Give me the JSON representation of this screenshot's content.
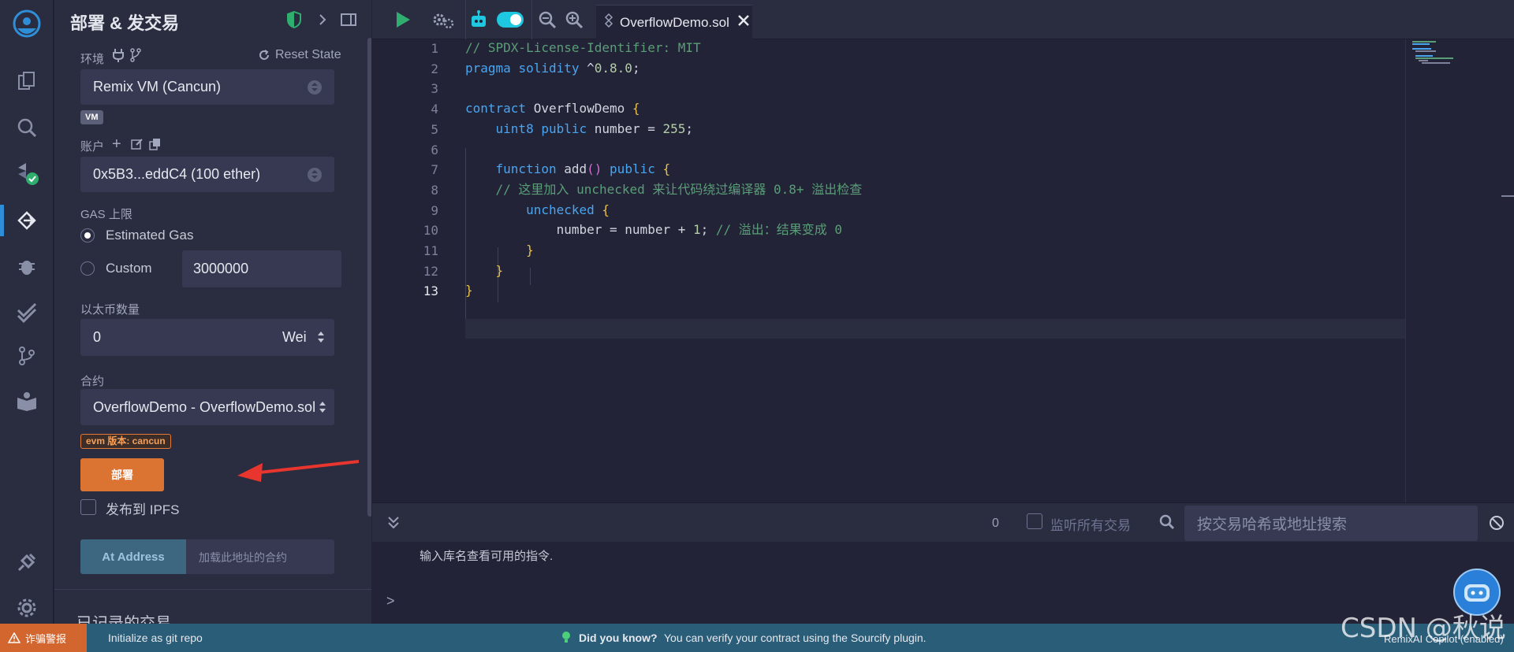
{
  "panel": {
    "title": "部署 & 发交易",
    "env_label": "环境",
    "reset_state": "Reset State",
    "env_value": "Remix VM (Cancun)",
    "vm_badge": "VM",
    "account_label": "账户",
    "account_value": "0x5B3...eddC4 (100 ether)",
    "gas_label": "GAS 上限",
    "gas_estimated": "Estimated Gas",
    "gas_custom": "Custom",
    "gas_custom_value": "3000000",
    "value_label": "以太币数量",
    "value_amount": "0",
    "value_unit": "Wei",
    "contract_label": "合约",
    "contract_value": "OverflowDemo - OverflowDemo.sol",
    "evm_badge": "evm 版本: cancun",
    "deploy_button": "部署",
    "publish_ipfs": "发布到 IPFS",
    "at_address_button": "At Address",
    "at_address_placeholder": "加载此地址的合约",
    "recorded_tx": "已记录的交易"
  },
  "editor": {
    "tab_name": "OverflowDemo.sol",
    "line_numbers": [
      "1",
      "2",
      "3",
      "4",
      "5",
      "6",
      "7",
      "8",
      "9",
      "10",
      "11",
      "12",
      "13"
    ],
    "lines": [
      "// SPDX-License-Identifier: MIT",
      "pragma solidity ^0.8.0;",
      "",
      "contract OverflowDemo {",
      "    uint8 public number = 255;",
      "",
      "    function add() public {",
      "    // 这里加入 unchecked 来让代码绕过编译器 0.8+ 溢出检查",
      "        unchecked {",
      "            number = number + 1; // 溢出：结果变成 0",
      "        }",
      "    }",
      "}"
    ]
  },
  "terminal": {
    "tx_count": "0",
    "listen_all": "监听所有交易",
    "search_placeholder": "按交易哈希或地址搜索",
    "hint": "输入库名查看可用的指令.",
    "prompt": ">"
  },
  "status": {
    "scam_alert": "诈骗警报",
    "git_init": "Initialize as git repo",
    "did_you_know": "Did you know?",
    "tip": "You can verify your contract using the Sourcify plugin.",
    "copilot": "RemixAI Copilot (enabled)"
  },
  "watermark": "CSDN @秋说",
  "colors": {
    "accent": "#2e8fd8",
    "deploy": "#db7433",
    "status_bar": "#2a5d77",
    "toggle_on": "#1ec8e0"
  }
}
